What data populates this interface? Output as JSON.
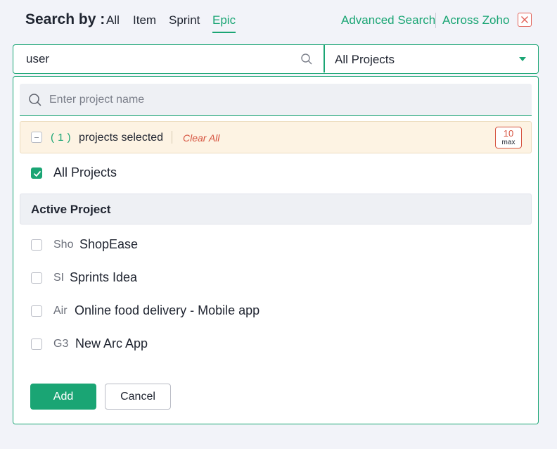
{
  "header": {
    "search_by_label": "Search by :",
    "tabs": [
      {
        "label": "All",
        "active": false
      },
      {
        "label": "Item",
        "active": false
      },
      {
        "label": "Sprint",
        "active": false
      },
      {
        "label": "Epic",
        "active": true
      }
    ],
    "advanced_search": "Advanced Search",
    "across_zoho": "Across Zoho",
    "close_icon": "close-icon"
  },
  "search": {
    "query": "user",
    "search_icon": "search-icon",
    "project_select_value": "All Projects",
    "dropdown_icon": "caret-down-icon"
  },
  "dropdown": {
    "filter_placeholder": "Enter project name",
    "selected_count": "( 1 )",
    "selected_text": "projects selected",
    "clear_all": "Clear All",
    "max_value": "10",
    "max_label": "max",
    "all_projects": {
      "label": "All Projects",
      "checked": true
    },
    "group_label": "Active Project",
    "projects": [
      {
        "prefix": "Sho",
        "name": "ShopEase",
        "checked": false
      },
      {
        "prefix": "SI",
        "name": "Sprints Idea",
        "checked": false
      },
      {
        "prefix": "Air",
        "name": "Online food delivery - Mobile app",
        "checked": false
      },
      {
        "prefix": "G3",
        "name": "New Arc App",
        "checked": false
      }
    ],
    "add_label": "Add",
    "cancel_label": "Cancel"
  },
  "colors": {
    "accent": "#1aa574",
    "danger": "#d6533f",
    "selected_bar_bg": "#fdf3e3",
    "header_bg": "#f2f3f9"
  }
}
